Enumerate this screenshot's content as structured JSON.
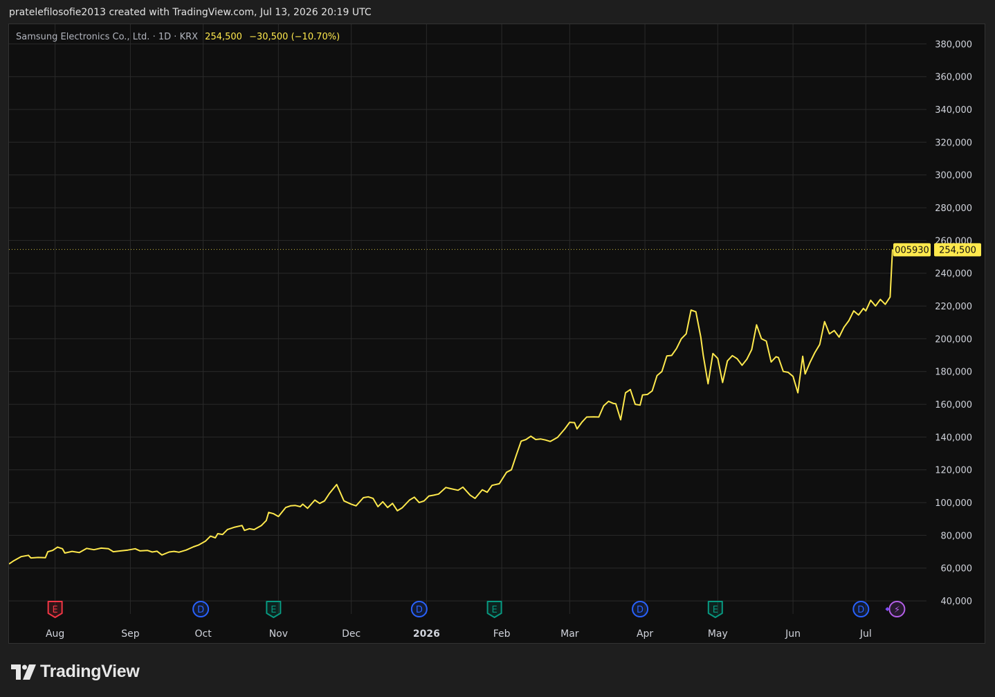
{
  "header": {
    "snapshot_text": "pratelefilosofie2013 created with TradingView.com, Jul 13, 2026 20:19 UTC"
  },
  "legend": {
    "symbol_name": "Samsung Electronics Co., Ltd.",
    "separator": "·",
    "interval": "1D",
    "exchange": "KRX",
    "last_price": "254,500",
    "change": "−30,500 (−10.70%)"
  },
  "branding": {
    "logo_text": "TradingView"
  },
  "colors": {
    "line": "#ffe94d",
    "background": "#0f0f0f",
    "grid": "#2a2a2a",
    "axis_text": "#d1d4dc",
    "earnings_red": "#f23645",
    "earnings_teal": "#089981",
    "dividend_blue": "#2962ff",
    "lightning_purple": "#b45fe8"
  },
  "chart_data": {
    "type": "line",
    "series_name": "Samsung Electronics Co., Ltd.",
    "last_value_label": "254,500",
    "symbol_tag": "005930",
    "y_range": [
      32000,
      392000
    ],
    "y_ticks": [
      40000,
      60000,
      80000,
      100000,
      120000,
      140000,
      160000,
      180000,
      200000,
      220000,
      240000,
      260000,
      280000,
      300000,
      320000,
      340000,
      360000,
      380000
    ],
    "y_tick_labels": [
      "40,000",
      "60,000",
      "80,000",
      "100,000",
      "120,000",
      "140,000",
      "160,000",
      "180,000",
      "200,000",
      "220,000",
      "240,000",
      "260,000",
      "280,000",
      "300,000",
      "320,000",
      "340,000",
      "360,000",
      "380,000"
    ],
    "x_range": [
      "2025-07-13",
      "2026-07-26"
    ],
    "x_ticks": [
      {
        "date": "2025-08-01",
        "label": "Aug",
        "bold": false
      },
      {
        "date": "2025-09-01",
        "label": "Sep",
        "bold": false
      },
      {
        "date": "2025-10-01",
        "label": "Oct",
        "bold": false
      },
      {
        "date": "2025-11-01",
        "label": "Nov",
        "bold": false
      },
      {
        "date": "2025-12-01",
        "label": "Dec",
        "bold": false
      },
      {
        "date": "2026-01-01",
        "label": "2026",
        "bold": true
      },
      {
        "date": "2026-02-01",
        "label": "Feb",
        "bold": false
      },
      {
        "date": "2026-03-01",
        "label": "Mar",
        "bold": false
      },
      {
        "date": "2026-04-01",
        "label": "Apr",
        "bold": false
      },
      {
        "date": "2026-05-01",
        "label": "May",
        "bold": false
      },
      {
        "date": "2026-06-01",
        "label": "Jun",
        "bold": false
      },
      {
        "date": "2026-07-01",
        "label": "Jul",
        "bold": false
      }
    ],
    "points": [
      [
        "2025-07-13",
        62500
      ],
      [
        "2025-07-15",
        64500
      ],
      [
        "2025-07-18",
        67000
      ],
      [
        "2025-07-21",
        67800
      ],
      [
        "2025-07-22",
        66200
      ],
      [
        "2025-07-25",
        66500
      ],
      [
        "2025-07-28",
        66300
      ],
      [
        "2025-07-29",
        70000
      ],
      [
        "2025-07-31",
        70800
      ],
      [
        "2025-08-02",
        72800
      ],
      [
        "2025-08-04",
        71800
      ],
      [
        "2025-08-05",
        69200
      ],
      [
        "2025-08-08",
        70200
      ],
      [
        "2025-08-11",
        69500
      ],
      [
        "2025-08-14",
        72000
      ],
      [
        "2025-08-17",
        71200
      ],
      [
        "2025-08-20",
        72200
      ],
      [
        "2025-08-23",
        71800
      ],
      [
        "2025-08-25",
        70000
      ],
      [
        "2025-08-28",
        70500
      ],
      [
        "2025-08-31",
        71000
      ],
      [
        "2025-09-03",
        71800
      ],
      [
        "2025-09-05",
        70500
      ],
      [
        "2025-09-08",
        70800
      ],
      [
        "2025-09-10",
        69800
      ],
      [
        "2025-09-12",
        70300
      ],
      [
        "2025-09-14",
        68000
      ],
      [
        "2025-09-17",
        69800
      ],
      [
        "2025-09-19",
        70200
      ],
      [
        "2025-09-21",
        69700
      ],
      [
        "2025-09-24",
        71000
      ],
      [
        "2025-09-27",
        73000
      ],
      [
        "2025-09-29",
        74000
      ],
      [
        "2025-10-02",
        76500
      ],
      [
        "2025-10-04",
        79500
      ],
      [
        "2025-10-06",
        78500
      ],
      [
        "2025-10-07",
        81000
      ],
      [
        "2025-10-09",
        80500
      ],
      [
        "2025-10-11",
        83500
      ],
      [
        "2025-10-14",
        85000
      ],
      [
        "2025-10-17",
        86000
      ],
      [
        "2025-10-18",
        83000
      ],
      [
        "2025-10-20",
        84000
      ],
      [
        "2025-10-22",
        83500
      ],
      [
        "2025-10-25",
        86000
      ],
      [
        "2025-10-27",
        89000
      ],
      [
        "2025-10-28",
        94000
      ],
      [
        "2025-10-30",
        93200
      ],
      [
        "2025-11-01",
        91500
      ],
      [
        "2025-11-04",
        97000
      ],
      [
        "2025-11-06",
        98000
      ],
      [
        "2025-11-08",
        98200
      ],
      [
        "2025-11-10",
        97500
      ],
      [
        "2025-11-11",
        99000
      ],
      [
        "2025-11-13",
        96500
      ],
      [
        "2025-11-16",
        101500
      ],
      [
        "2025-11-18",
        99500
      ],
      [
        "2025-11-20",
        101000
      ],
      [
        "2025-11-22",
        105500
      ],
      [
        "2025-11-25",
        111000
      ],
      [
        "2025-11-28",
        101000
      ],
      [
        "2025-12-01",
        99000
      ],
      [
        "2025-12-03",
        98000
      ],
      [
        "2025-12-06",
        103000
      ],
      [
        "2025-12-08",
        103500
      ],
      [
        "2025-12-10",
        102500
      ],
      [
        "2025-12-12",
        97500
      ],
      [
        "2025-12-14",
        100500
      ],
      [
        "2025-12-16",
        97000
      ],
      [
        "2025-12-18",
        99500
      ],
      [
        "2025-12-20",
        95000
      ],
      [
        "2025-12-22",
        96800
      ],
      [
        "2025-12-25",
        101500
      ],
      [
        "2025-12-27",
        103300
      ],
      [
        "2025-12-29",
        100000
      ],
      [
        "2025-12-31",
        101000
      ],
      [
        "2026-01-02",
        104000
      ],
      [
        "2026-01-04",
        104500
      ],
      [
        "2026-01-06",
        105200
      ],
      [
        "2026-01-09",
        109200
      ],
      [
        "2026-01-11",
        108500
      ],
      [
        "2026-01-14",
        107500
      ],
      [
        "2026-01-16",
        109400
      ],
      [
        "2026-01-19",
        104500
      ],
      [
        "2026-01-21",
        102500
      ],
      [
        "2026-01-24",
        107800
      ],
      [
        "2026-01-26",
        106300
      ],
      [
        "2026-01-28",
        110500
      ],
      [
        "2026-01-31",
        111500
      ],
      [
        "2026-02-03",
        118500
      ],
      [
        "2026-02-05",
        120000
      ],
      [
        "2026-02-07",
        129000
      ],
      [
        "2026-02-09",
        137500
      ],
      [
        "2026-02-11",
        138500
      ],
      [
        "2026-02-13",
        140500
      ],
      [
        "2026-02-15",
        138500
      ],
      [
        "2026-02-17",
        138800
      ],
      [
        "2026-02-19",
        138200
      ],
      [
        "2026-02-21",
        137300
      ],
      [
        "2026-02-24",
        139800
      ],
      [
        "2026-02-27",
        145000
      ],
      [
        "2026-03-01",
        149000
      ],
      [
        "2026-03-03",
        148800
      ],
      [
        "2026-03-04",
        145000
      ],
      [
        "2026-03-06",
        149000
      ],
      [
        "2026-03-08",
        152200
      ],
      [
        "2026-03-11",
        152300
      ],
      [
        "2026-03-13",
        152200
      ],
      [
        "2026-03-15",
        159000
      ],
      [
        "2026-03-17",
        161800
      ],
      [
        "2026-03-19",
        160500
      ],
      [
        "2026-03-20",
        160300
      ],
      [
        "2026-03-22",
        150500
      ],
      [
        "2026-03-24",
        167000
      ],
      [
        "2026-03-26",
        169000
      ],
      [
        "2026-03-28",
        160000
      ],
      [
        "2026-03-30",
        159500
      ],
      [
        "2026-03-31",
        165700
      ],
      [
        "2026-04-02",
        166000
      ],
      [
        "2026-04-04",
        168200
      ],
      [
        "2026-04-06",
        177500
      ],
      [
        "2026-04-08",
        180000
      ],
      [
        "2026-04-10",
        189500
      ],
      [
        "2026-04-12",
        189800
      ],
      [
        "2026-04-14",
        194000
      ],
      [
        "2026-04-16",
        200000
      ],
      [
        "2026-04-18",
        203000
      ],
      [
        "2026-04-20",
        217500
      ],
      [
        "2026-04-22",
        216500
      ],
      [
        "2026-04-24",
        201000
      ],
      [
        "2026-04-25",
        190000
      ],
      [
        "2026-04-27",
        172500
      ],
      [
        "2026-04-29",
        191000
      ],
      [
        "2026-05-01",
        188000
      ],
      [
        "2026-05-03",
        173300
      ],
      [
        "2026-05-05",
        186500
      ],
      [
        "2026-05-07",
        189700
      ],
      [
        "2026-05-09",
        187800
      ],
      [
        "2026-05-11",
        183800
      ],
      [
        "2026-05-13",
        187500
      ],
      [
        "2026-05-15",
        193400
      ],
      [
        "2026-05-17",
        208500
      ],
      [
        "2026-05-19",
        200000
      ],
      [
        "2026-05-21",
        198500
      ],
      [
        "2026-05-23",
        185800
      ],
      [
        "2026-05-25",
        189000
      ],
      [
        "2026-05-26",
        188500
      ],
      [
        "2026-05-28",
        180000
      ],
      [
        "2026-05-30",
        179500
      ],
      [
        "2026-06-01",
        177000
      ],
      [
        "2026-06-03",
        167000
      ],
      [
        "2026-06-05",
        189300
      ],
      [
        "2026-06-06",
        178500
      ],
      [
        "2026-06-08",
        185500
      ],
      [
        "2026-06-10",
        191500
      ],
      [
        "2026-06-12",
        196500
      ],
      [
        "2026-06-14",
        210500
      ],
      [
        "2026-06-16",
        203000
      ],
      [
        "2026-06-18",
        205000
      ],
      [
        "2026-06-20",
        201000
      ],
      [
        "2026-06-22",
        207000
      ],
      [
        "2026-06-24",
        211000
      ],
      [
        "2026-06-26",
        217000
      ],
      [
        "2026-06-28",
        214500
      ],
      [
        "2026-06-30",
        218500
      ],
      [
        "2026-07-01",
        217000
      ],
      [
        "2026-07-03",
        223500
      ],
      [
        "2026-07-05",
        220000
      ],
      [
        "2026-07-07",
        224000
      ],
      [
        "2026-07-09",
        221000
      ],
      [
        "2026-07-11",
        225500
      ],
      [
        "2026-07-12",
        254500
      ]
    ],
    "markers": [
      {
        "type": "earnings",
        "date": "2025-08-01",
        "letter": "E",
        "color": "earnings_red"
      },
      {
        "type": "dividend",
        "date": "2025-09-30",
        "letter": "D",
        "color": "dividend_blue"
      },
      {
        "type": "earnings",
        "date": "2025-10-30",
        "letter": "E",
        "color": "earnings_teal"
      },
      {
        "type": "dividend",
        "date": "2025-12-29",
        "letter": "D",
        "color": "dividend_blue"
      },
      {
        "type": "earnings",
        "date": "2026-01-29",
        "letter": "E",
        "color": "earnings_teal"
      },
      {
        "type": "dividend",
        "date": "2026-03-30",
        "letter": "D",
        "color": "dividend_blue"
      },
      {
        "type": "earnings",
        "date": "2026-04-30",
        "letter": "E",
        "color": "earnings_teal"
      },
      {
        "type": "dividend",
        "date": "2026-06-29",
        "letter": "D",
        "color": "dividend_blue"
      },
      {
        "type": "lightning",
        "date": "2026-07-13",
        "letter": "⚡",
        "color": "lightning_purple"
      }
    ]
  }
}
